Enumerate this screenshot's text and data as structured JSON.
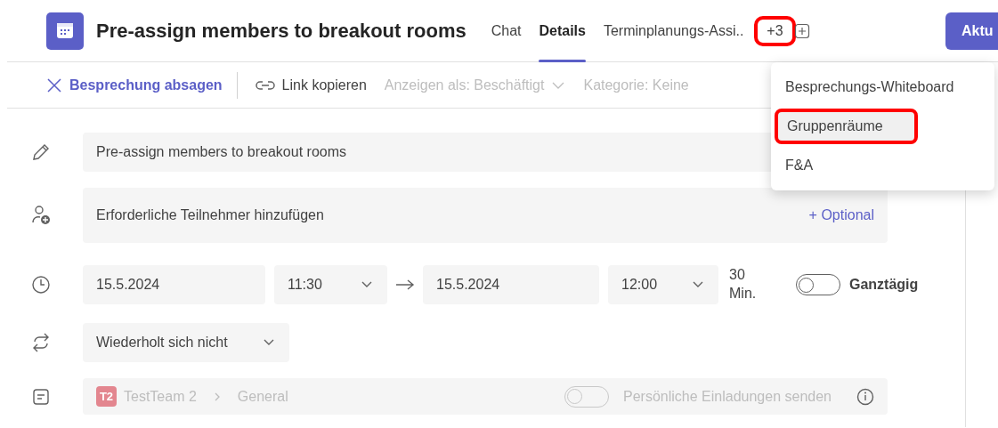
{
  "header": {
    "title": "Pre-assign members to breakout rooms",
    "tabs": [
      {
        "label": "Chat",
        "selected": false
      },
      {
        "label": "Details",
        "selected": true
      },
      {
        "label": "Terminplanungs-Assi..",
        "selected": false
      }
    ],
    "overflow": {
      "label": "+3",
      "highlighted": true
    },
    "action_button": "Aktu"
  },
  "toolbar": {
    "items": [
      {
        "kind": "cancel",
        "label": "Besprechung absagen",
        "disabled": false
      },
      {
        "kind": "link",
        "label": "Link kopieren",
        "disabled": false
      },
      {
        "kind": "dropdown",
        "label": "Anzeigen als: Beschäftigt",
        "disabled": true
      },
      {
        "kind": "text",
        "label": "Kategorie: Keine",
        "disabled": true
      }
    ]
  },
  "form": {
    "title": "Pre-assign members to breakout rooms",
    "attendees": {
      "placeholder": "Erforderliche Teilnehmer hinzufügen",
      "optional": "+ Optional"
    },
    "start_date": "15.5.2024",
    "start_time": "11:30",
    "end_date": "15.5.2024",
    "end_time": "12:00",
    "duration": "30 Min.",
    "all_day": {
      "label": "Ganztägig",
      "on": false
    },
    "repeat": "Wiederholt sich nicht",
    "channel": {
      "badge": "T2",
      "color": "#e3868f",
      "team": "TestTeam 2",
      "name": "General"
    },
    "personal_invites": {
      "label": "Persönliche Einladungen senden",
      "on": false,
      "disabled": true
    }
  },
  "menu": {
    "items": [
      {
        "label": "Besprechungs-Whiteboard",
        "selected": false,
        "highlighted": false
      },
      {
        "label": "Gruppenräume",
        "selected": true,
        "highlighted": true
      },
      {
        "label": "F&A",
        "selected": false,
        "highlighted": false
      }
    ]
  }
}
